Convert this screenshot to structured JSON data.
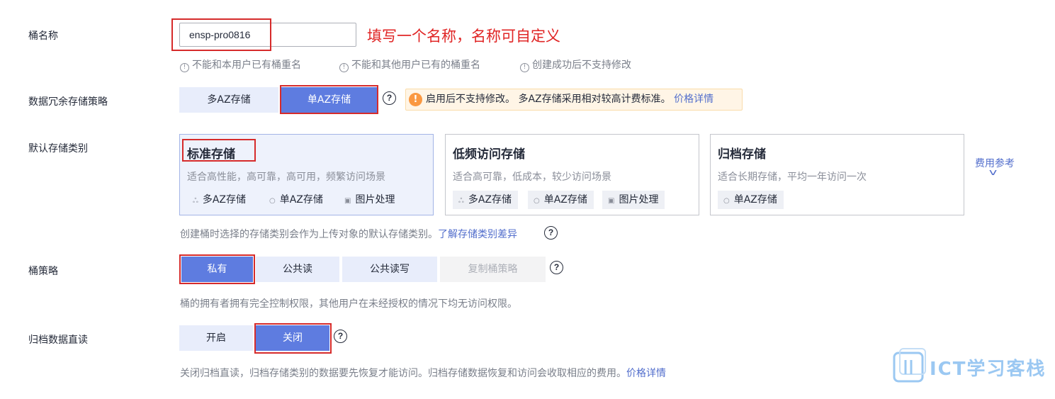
{
  "bucket_name": {
    "label": "桶名称",
    "value": "ensp-pro0816",
    "annotation": "填写一个名称，名称可自定义",
    "hints": [
      "不能和本用户已有桶重名",
      "不能和其他用户已有的桶重名",
      "创建成功后不支持修改"
    ]
  },
  "redundancy": {
    "label": "数据冗余存储策略",
    "options": [
      "多AZ存储",
      "单AZ存储"
    ],
    "selected": "单AZ存储",
    "warning": "启用后不支持修改。 多AZ存储采用相对较高计费标准。",
    "warning_link": "价格详情"
  },
  "storage_class": {
    "label": "默认存储类别",
    "cards": [
      {
        "title": "标准存储",
        "desc": "适合高性能，高可靠，高可用，频繁访问场景",
        "tags": [
          "多AZ存储",
          "单AZ存储",
          "图片处理"
        ]
      },
      {
        "title": "低频访问存储",
        "desc": "适合高可靠，低成本，较少访问场景",
        "tags": [
          "多AZ存储",
          "单AZ存储",
          "图片处理"
        ]
      },
      {
        "title": "归档存储",
        "desc": "适合长期存储，平均一年访问一次",
        "tags": [
          "单AZ存储"
        ]
      }
    ],
    "fee_link": "费用参考",
    "hint": "创建桶时选择的存储类别会作为上传对象的默认存储类别。",
    "hint_link": "了解存储类别差异"
  },
  "policy": {
    "label": "桶策略",
    "options": [
      "私有",
      "公共读",
      "公共读写",
      "复制桶策略"
    ],
    "selected": "私有",
    "hint": "桶的拥有者拥有完全控制权限，其他用户在未经授权的情况下均无访问权限。"
  },
  "archive_read": {
    "label": "归档数据直读",
    "options": [
      "开启",
      "关闭"
    ],
    "selected": "关闭",
    "hint": "关闭归档直读，归档存储类别的数据要先恢复才能访问。归档存储数据恢复和访问会收取相应的费用。",
    "hint_link": "价格详情"
  },
  "watermark": "ICT学习客栈",
  "colors": {
    "primary": "#5e7ce0",
    "annotation_red": "#d62b2b",
    "link": "#526ecc",
    "warning": "#fa9841"
  }
}
